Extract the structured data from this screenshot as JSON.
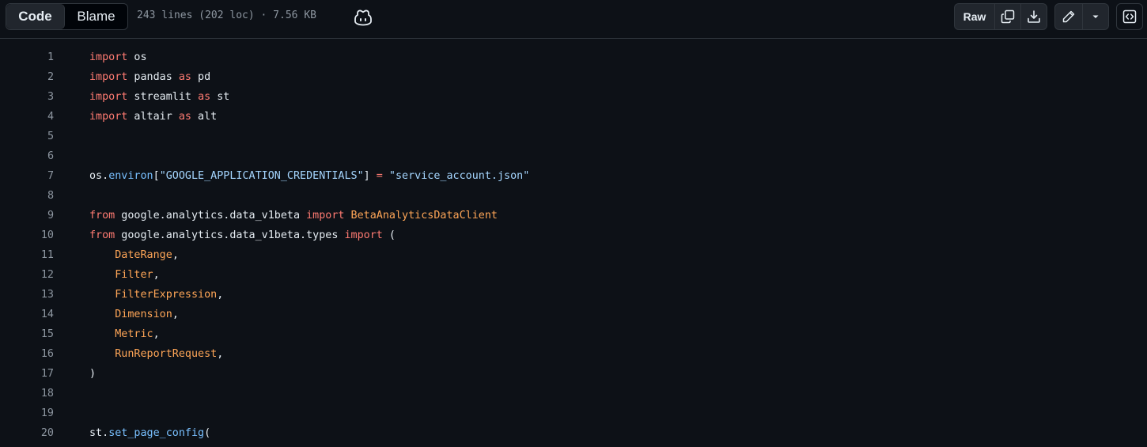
{
  "toolbar": {
    "code_tab": "Code",
    "blame_tab": "Blame",
    "file_meta": "243 lines (202 loc) · 7.56 KB",
    "raw_label": "Raw",
    "icons": [
      "copilot-icon",
      "copy-icon",
      "download-icon",
      "pencil-icon",
      "triangle-down-icon",
      "code-square-icon"
    ]
  },
  "colors": {
    "background": "#0d1117",
    "keyword": "#ff7b72",
    "class": "#ffa657",
    "function": "#79c0ff",
    "string": "#a5d6ff",
    "line_number": "#8d96a0"
  },
  "code": {
    "lines": [
      {
        "n": "1",
        "tokens": [
          [
            "kw",
            "import"
          ],
          [
            "p",
            " os"
          ]
        ]
      },
      {
        "n": "2",
        "tokens": [
          [
            "kw",
            "import"
          ],
          [
            "p",
            " pandas "
          ],
          [
            "kw",
            "as"
          ],
          [
            "p",
            " pd"
          ]
        ]
      },
      {
        "n": "3",
        "tokens": [
          [
            "kw",
            "import"
          ],
          [
            "p",
            " streamlit "
          ],
          [
            "kw",
            "as"
          ],
          [
            "p",
            " st"
          ]
        ]
      },
      {
        "n": "4",
        "tokens": [
          [
            "kw",
            "import"
          ],
          [
            "p",
            " altair "
          ],
          [
            "kw",
            "as"
          ],
          [
            "p",
            " alt"
          ]
        ]
      },
      {
        "n": "5",
        "tokens": []
      },
      {
        "n": "6",
        "tokens": []
      },
      {
        "n": "7",
        "tokens": [
          [
            "p",
            "os."
          ],
          [
            "fn",
            "environ"
          ],
          [
            "p",
            "["
          ],
          [
            "str",
            "\"GOOGLE_APPLICATION_CREDENTIALS\""
          ],
          [
            "p",
            "] "
          ],
          [
            "kw",
            "="
          ],
          [
            "p",
            " "
          ],
          [
            "str",
            "\"service_account.json\""
          ]
        ]
      },
      {
        "n": "8",
        "tokens": []
      },
      {
        "n": "9",
        "tokens": [
          [
            "kw",
            "from"
          ],
          [
            "p",
            " google.analytics.data_v1beta "
          ],
          [
            "kw",
            "import"
          ],
          [
            "p",
            " "
          ],
          [
            "cls",
            "BetaAnalyticsDataClient"
          ]
        ]
      },
      {
        "n": "10",
        "tokens": [
          [
            "kw",
            "from"
          ],
          [
            "p",
            " google.analytics.data_v1beta.types "
          ],
          [
            "kw",
            "import"
          ],
          [
            "p",
            " ("
          ]
        ]
      },
      {
        "n": "11",
        "tokens": [
          [
            "p",
            "    "
          ],
          [
            "cls",
            "DateRange"
          ],
          [
            "p",
            ","
          ]
        ]
      },
      {
        "n": "12",
        "tokens": [
          [
            "p",
            "    "
          ],
          [
            "cls",
            "Filter"
          ],
          [
            "p",
            ","
          ]
        ]
      },
      {
        "n": "13",
        "tokens": [
          [
            "p",
            "    "
          ],
          [
            "cls",
            "FilterExpression"
          ],
          [
            "p",
            ","
          ]
        ]
      },
      {
        "n": "14",
        "tokens": [
          [
            "p",
            "    "
          ],
          [
            "cls",
            "Dimension"
          ],
          [
            "p",
            ","
          ]
        ]
      },
      {
        "n": "15",
        "tokens": [
          [
            "p",
            "    "
          ],
          [
            "cls",
            "Metric"
          ],
          [
            "p",
            ","
          ]
        ]
      },
      {
        "n": "16",
        "tokens": [
          [
            "p",
            "    "
          ],
          [
            "cls",
            "RunReportRequest"
          ],
          [
            "p",
            ","
          ]
        ]
      },
      {
        "n": "17",
        "tokens": [
          [
            "p",
            ")"
          ]
        ]
      },
      {
        "n": "18",
        "tokens": []
      },
      {
        "n": "19",
        "tokens": []
      },
      {
        "n": "20",
        "tokens": [
          [
            "p",
            "st."
          ],
          [
            "fn",
            "set_page_config"
          ],
          [
            "p",
            "("
          ]
        ]
      }
    ]
  }
}
